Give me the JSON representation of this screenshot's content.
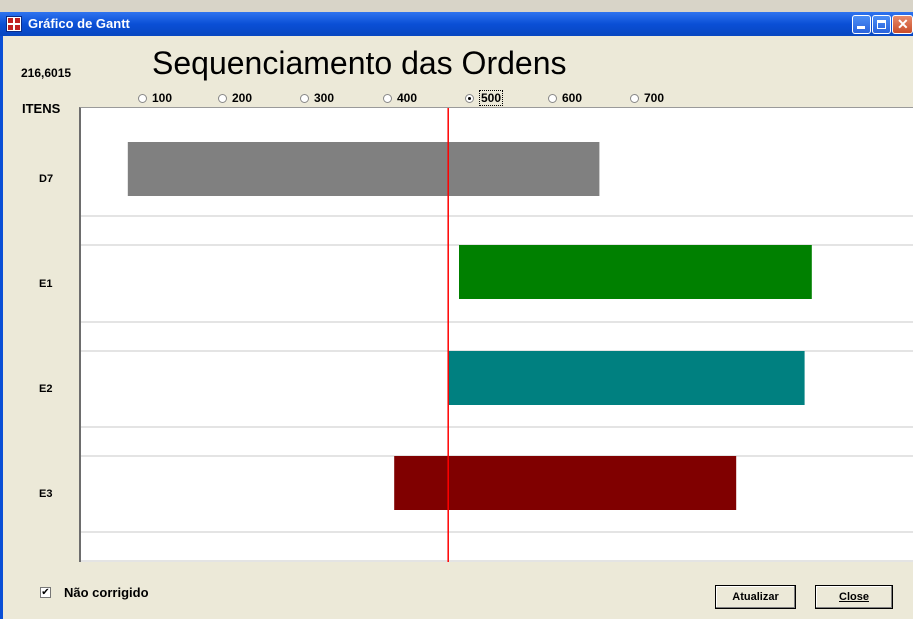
{
  "window": {
    "title": "Gráfico de Gantt"
  },
  "header": {
    "value": "216,6015",
    "chart_title": "Sequenciamento das Ordens",
    "rows_label": "ITENS"
  },
  "scale_options": [
    {
      "label": "100",
      "selected": false
    },
    {
      "label": "200",
      "selected": false
    },
    {
      "label": "300",
      "selected": false
    },
    {
      "label": "400",
      "selected": false
    },
    {
      "label": "500",
      "selected": true
    },
    {
      "label": "600",
      "selected": false
    },
    {
      "label": "700",
      "selected": false
    }
  ],
  "footer": {
    "checkbox_label": "Não corrigido",
    "checkbox_checked": true,
    "refresh_label": "Atualizar",
    "close_label": "Close"
  },
  "chart_data": {
    "type": "gantt",
    "rows": [
      {
        "label": "D7",
        "start": 13,
        "end": 144,
        "color": "#808080"
      },
      {
        "label": "E1",
        "start": 105,
        "end": 203,
        "color": "#008000"
      },
      {
        "label": "E2",
        "start": 102,
        "end": 201,
        "color": "#008080"
      },
      {
        "label": "E3",
        "start": 87,
        "end": 182,
        "color": "#800000"
      }
    ],
    "marker": {
      "value": 102,
      "color": "#ff0000"
    },
    "x_range": [
      0,
      230
    ]
  }
}
